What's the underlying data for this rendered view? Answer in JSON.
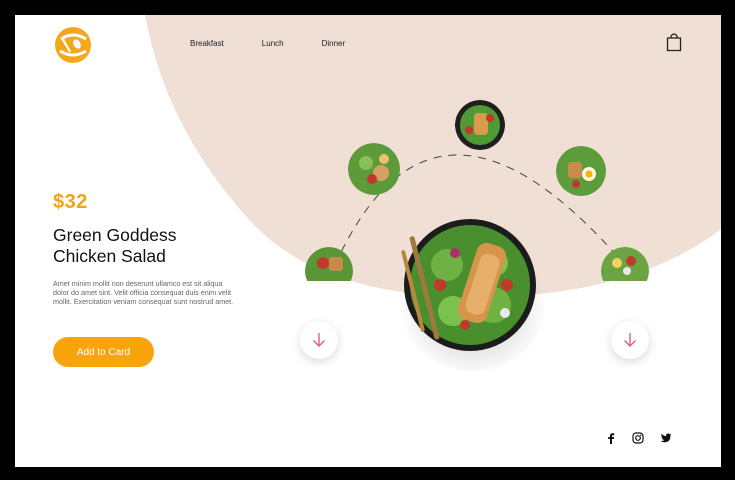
{
  "nav": {
    "items": [
      "Breakfast",
      "Lunch",
      "Dinner"
    ]
  },
  "product": {
    "price": "$32",
    "title_line1": "Green Goddess",
    "title_line2": "Chicken Salad",
    "description": "Amet minim mollit non deserunt ullamco est sit aliqua dolor do amet sint. Velit officia consequat duis enim velit mollit. Exercitation veniam consequat sunt nostrud amet.",
    "cta_label": "Add to Card"
  },
  "colors": {
    "accent": "#f9a40b",
    "price": "#f5a214",
    "blob": "#efdfd5",
    "arrow": "#e0607a"
  },
  "icons": {
    "logo": "fork-spoon-logo",
    "cart": "shopping-bag-icon",
    "prev": "arrow-down-icon",
    "next": "arrow-down-icon",
    "social": [
      "facebook-icon",
      "instagram-icon",
      "twitter-icon"
    ]
  }
}
